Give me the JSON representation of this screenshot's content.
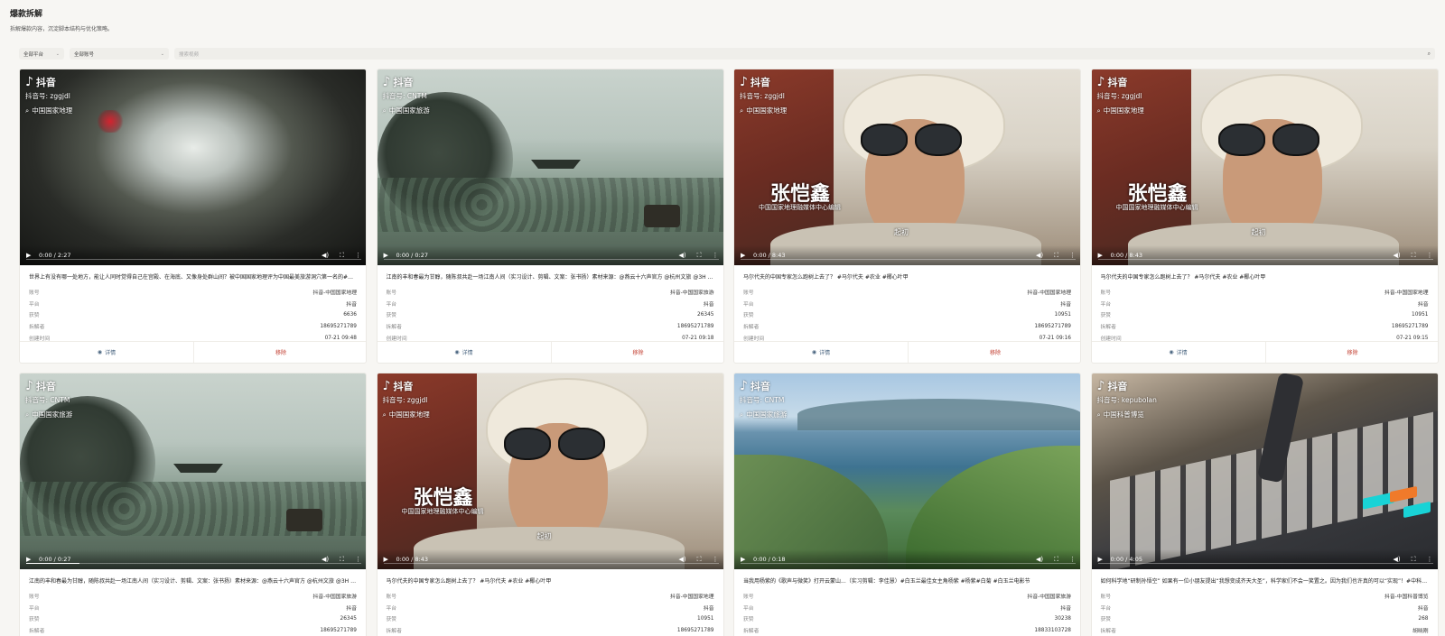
{
  "header": {
    "title": "爆款拆解",
    "subtitle": "拆解爆款内容，沉淀脚本结构与优化策略。"
  },
  "filters": {
    "platform": "全部平台",
    "account": "全部账号",
    "search_placeholder": "搜索视频"
  },
  "labels": {
    "account": "账号",
    "platform": "平台",
    "likes": "获赞",
    "analyst": "拆解者",
    "created": "创建时间",
    "detail": "详情",
    "remove": "移除"
  },
  "cards": [
    {
      "scene": "cave",
      "wm_logo": "抖音",
      "wm_id": "抖音号: zggjdl",
      "wm_search": "中国国家地理",
      "time": "0:00 / 2:27",
      "progress": 0,
      "caption": "世界上有没有哪一处地方，能让人同时觉得自己在宫殿、在海底、又像身处群山间？被中国国家地理评为中国最美旅游洞穴第一名的#贵...",
      "account": "抖音-中国国家地理",
      "platform": "抖音",
      "likes": "6636",
      "analyst": "18695271789",
      "created": "07-21 09:48"
    },
    {
      "scene": "lake",
      "wm_logo": "抖音",
      "wm_id": "抖音号: CNTM",
      "wm_search": "中国国家旅游",
      "time": "0:00 / 0:27",
      "progress": 0,
      "caption": "江南的丰和春最为甘醇，随陈叔共赴一场江南人间（实习设计、剪辑、文案：张书扬）素材来源：@燕云十六声官方 @杭州文旅 @3H #...",
      "account": "抖音-中国国家旅游",
      "platform": "抖音",
      "likes": "26345",
      "analyst": "18695271789",
      "created": "07-21 09:18"
    },
    {
      "scene": "man",
      "wm_logo": "抖音",
      "wm_id": "抖音号: zggjdl",
      "wm_search": "中国国家地理",
      "brand": "张恺鑫",
      "brand_sub": "中国国家地理融媒体中心编辑",
      "sign": "起初",
      "time": "0:00 / 8:43",
      "progress": 0,
      "caption": "马尔代夫的中国专家怎么跑树上去了？ #马尔代夫 #农业 #椰心叶甲",
      "account": "抖音-中国国家地理",
      "platform": "抖音",
      "likes": "10951",
      "analyst": "18695271789",
      "created": "07-21 09:16"
    },
    {
      "scene": "man",
      "wm_logo": "抖音",
      "wm_id": "抖音号: zggjdl",
      "wm_search": "中国国家地理",
      "brand": "张恺鑫",
      "brand_sub": "中国国家地理融媒体中心编辑",
      "sign": "起初",
      "time": "0:00 / 8:43",
      "progress": 0,
      "caption": "马尔代夫的中国专家怎么跑树上去了？ #马尔代夫 #农业 #椰心叶甲",
      "account": "抖音-中国国家地理",
      "platform": "抖音",
      "likes": "10951",
      "analyst": "18695271789",
      "created": "07-21 09:15"
    },
    {
      "scene": "lake",
      "wm_logo": "抖音",
      "wm_id": "抖音号: CNTM",
      "wm_search": "中国国家旅游",
      "time": "0:00 / 0:27",
      "progress": 0.16,
      "caption": "江南的丰和春最为甘醇，随陈叔共赴一场江南人间（实习设计、剪辑、文案：张书扬）素材来源：@燕云十六声官方 @杭州文旅 @3H #...",
      "account": "抖音-中国国家旅游",
      "platform": "抖音",
      "likes": "26345",
      "analyst": "18695271789",
      "created": ""
    },
    {
      "scene": "man",
      "wm_logo": "抖音",
      "wm_id": "抖音号: zggjdl",
      "wm_search": "中国国家地理",
      "brand": "张恺鑫",
      "brand_sub": "中国国家地理融媒体中心编辑",
      "sign": "起初",
      "time": "0:00 / 8:43",
      "progress": 0,
      "caption": "马尔代夫的中国专家怎么跑树上去了？ #马尔代夫 #农业 #椰心叶甲",
      "account": "抖音-中国国家地理",
      "platform": "抖音",
      "likes": "10951",
      "analyst": "18695271789",
      "created": ""
    },
    {
      "scene": "coast",
      "wm_logo": "抖音",
      "wm_id": "抖音号: CNTM",
      "wm_search": "中国国家旅游",
      "time": "0:00 / 0:18",
      "progress": 0,
      "caption": "当我用杨紫的《歌声与微笑》打开云蒙山...（实习剪辑：李佳慧）#白玉兰最佳女主角杨紫 #杨紫#白菊 #白玉兰电影节",
      "account": "抖音-中国国家旅游",
      "platform": "抖音",
      "likes": "30238",
      "analyst": "18833103728",
      "created": ""
    },
    {
      "scene": "mixer",
      "wm_logo": "抖音",
      "wm_id": "抖音号: kepubolan",
      "wm_search": "中国科普博览",
      "time": "0:00 / 4:05",
      "progress": 0,
      "caption": "如何科学地“研制孙悟空” 如果有一位小朋友提出“我想变成齐天大圣”，科学家们不会一笑置之。因为我们也许真的可以“实现”！#中科院...",
      "account": "抖音-中国科普博览",
      "platform": "抖音",
      "likes": "268",
      "analyst": "胡晓刚",
      "created": ""
    }
  ]
}
